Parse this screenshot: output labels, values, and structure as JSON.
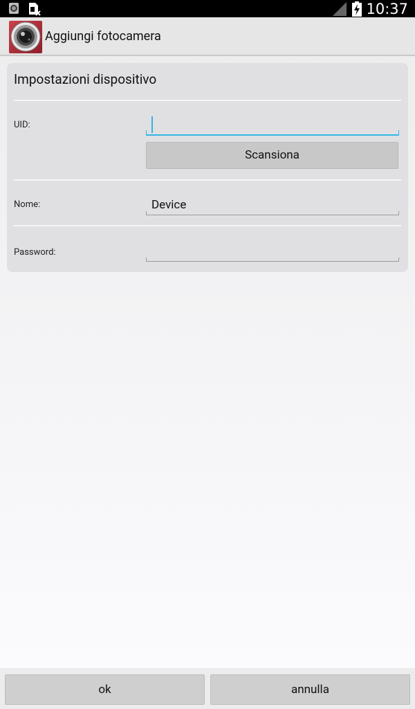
{
  "status_bar": {
    "time": "10:37",
    "icons": [
      "camera-notification-icon",
      "file-transfer-icon",
      "signal-icon",
      "battery-charging-icon"
    ]
  },
  "action_bar": {
    "title": "Aggiungi fotocamera",
    "icon": "camera-lens-app-icon"
  },
  "settings": {
    "title": "Impostazioni dispositivo",
    "uid": {
      "label": "UID:",
      "value": "",
      "placeholder": ""
    },
    "scan_button": "Scansiona",
    "name": {
      "label": "Nome:",
      "value": "Device"
    },
    "password": {
      "label": "Password:",
      "value": ""
    }
  },
  "buttons": {
    "ok": "ok",
    "cancel": "annulla"
  },
  "colors": {
    "accent": "#33b5e5",
    "status_bar": "#000000",
    "card": "#e0e0e2",
    "button": "#c8c8c8"
  }
}
